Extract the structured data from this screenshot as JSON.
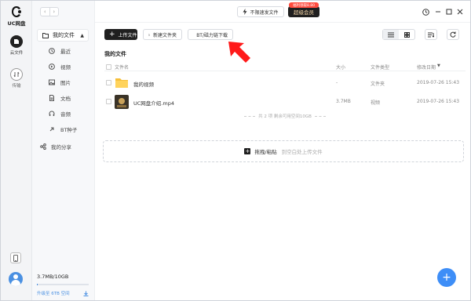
{
  "app": {
    "name": "UC网盘"
  },
  "rail": {
    "files_label": "云文件",
    "transfer_label": "传输"
  },
  "nav": {
    "my_files": "我的文件",
    "items": [
      {
        "label": "最近",
        "icon": "clock-icon"
      },
      {
        "label": "视频",
        "icon": "video-icon"
      },
      {
        "label": "图片",
        "icon": "image-icon"
      },
      {
        "label": "文档",
        "icon": "document-icon"
      },
      {
        "label": "音频",
        "icon": "audio-icon"
      },
      {
        "label": "BT种子",
        "icon": "torrent-icon"
      }
    ],
    "my_share": "我的分享"
  },
  "storage": {
    "used_text": "3.7MB/10GB",
    "used_fraction": 0.0004,
    "upgrade_text": "升级至 6TB 空间"
  },
  "topbar": {
    "no_sync": "不限速发文件",
    "vip_badge": "福利领取8.80",
    "vip_label": "超级会员"
  },
  "toolbar": {
    "upload": "上传文件",
    "new_folder": "新建文件夹",
    "bt_download": "BT/磁力链下载"
  },
  "content": {
    "breadcrumb": "我的文件",
    "columns": {
      "name": "文件名",
      "size": "大小",
      "type": "文件类型",
      "date": "修改日期"
    },
    "rows": [
      {
        "name": "我的视频",
        "size": "-",
        "type": "文件夹",
        "date": "2019-07-26 15:43",
        "icon": "folder-icon"
      },
      {
        "name": "UC网盘介绍.mp4",
        "size": "3.7MB",
        "type": "视频",
        "date": "2019-07-26 15:43",
        "icon": "video-thumbnail"
      }
    ],
    "summary": "共 2 项  剩余可用空间10GB",
    "dropzone_action": "拖拽/粘贴",
    "dropzone_hint": "到空白处上传文件"
  },
  "colors": {
    "accent": "#3e8ef7",
    "vip_badge": "#ff4b3e",
    "annotation_arrow": "#ff1a1a"
  }
}
